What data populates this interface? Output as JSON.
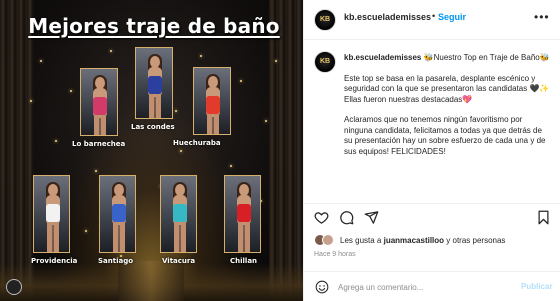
{
  "post": {
    "title": "Mejores traje de baño",
    "candidates": [
      {
        "name": "Lo barnechea",
        "suit": "#d23a6a"
      },
      {
        "name": "Las condes",
        "suit": "#2c3f9e"
      },
      {
        "name": "Huechuraba",
        "suit": "#e23b2b"
      },
      {
        "name": "Providencia",
        "suit": "#f2f2f2"
      },
      {
        "name": "Santiago",
        "suit": "#3a63c9"
      },
      {
        "name": "Vitacura",
        "suit": "#36b9c4"
      },
      {
        "name": "Chillan",
        "suit": "#d81f26"
      }
    ]
  },
  "header": {
    "username": "kb.escuelademisses",
    "dot": "•",
    "follow_label": "Seguir",
    "more_icon": "more-horizontal-icon"
  },
  "caption": {
    "avatar_text": "KB",
    "username": "kb.escuelademisses",
    "line1": "🐝Nuestro Top en Traje de Baño🐝",
    "paragraph1": "Este top se basa en la pasarela, desplante escénico y seguridad con la que se presentaron las candidatas 🖤✨",
    "paragraph1b": "Ellas fueron nuestras destacadas💖",
    "paragraph2": "Aclaramos que no tenemos ningún favoritismo por ninguna candidata, felicitamos a todas ya que detrás de su presentación hay un sobre esfuerzo de cada una y de sus equipos! FELICIDADES!"
  },
  "actions": {
    "icons": [
      "heart-icon",
      "comment-icon",
      "share-icon",
      "bookmark-icon"
    ]
  },
  "likes": {
    "prefix": "Les gusta a ",
    "user": "juanmacastilloo",
    "suffix": " y otras personas"
  },
  "time": "Hace 9 horas",
  "comment": {
    "placeholder": "Agrega un comentario...",
    "publish_label": "Publicar"
  },
  "colors": {
    "accent": "#0095f6",
    "publish_disabled": "#b2dffc",
    "gold": "#d6b06a"
  }
}
